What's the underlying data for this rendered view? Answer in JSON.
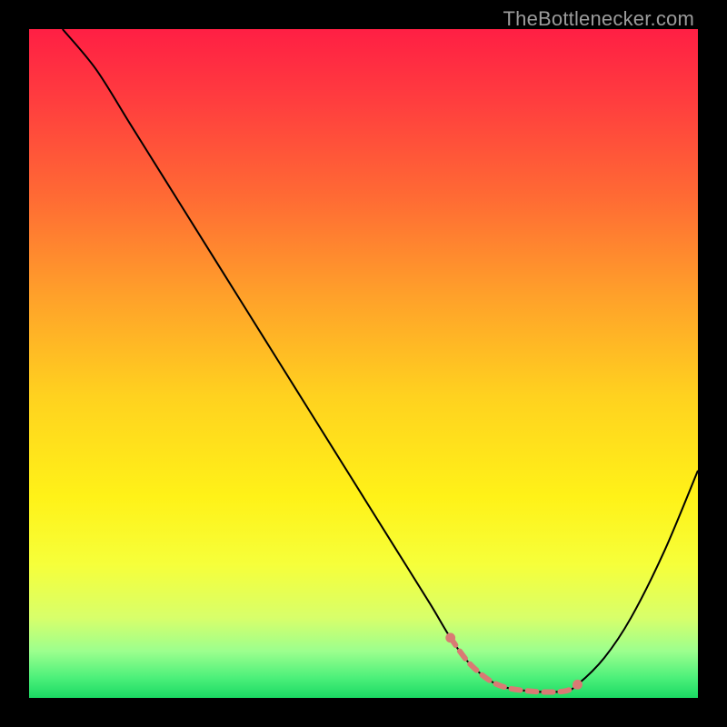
{
  "watermark": "TheBottlenecker.com",
  "chart_data": {
    "type": "line",
    "title": "",
    "xlabel": "",
    "ylabel": "",
    "xlim": [
      0,
      100
    ],
    "ylim": [
      0,
      100
    ],
    "grid": false,
    "background_gradient": {
      "stops": [
        {
          "offset": 0.0,
          "color": "#ff1f44"
        },
        {
          "offset": 0.1,
          "color": "#ff3b3f"
        },
        {
          "offset": 0.25,
          "color": "#ff6a34"
        },
        {
          "offset": 0.4,
          "color": "#ffa12a"
        },
        {
          "offset": 0.55,
          "color": "#ffd21f"
        },
        {
          "offset": 0.7,
          "color": "#fff218"
        },
        {
          "offset": 0.8,
          "color": "#f6ff3a"
        },
        {
          "offset": 0.88,
          "color": "#d8ff6a"
        },
        {
          "offset": 0.93,
          "color": "#9cff8e"
        },
        {
          "offset": 0.97,
          "color": "#4cf07a"
        },
        {
          "offset": 1.0,
          "color": "#1ad963"
        }
      ]
    },
    "series": [
      {
        "name": "bottleneck-curve",
        "color": "#000000",
        "width": 2,
        "x": [
          5,
          10,
          15,
          20,
          25,
          30,
          35,
          40,
          45,
          50,
          55,
          60,
          63,
          66,
          70,
          75,
          80,
          82,
          86,
          90,
          95,
          100
        ],
        "y": [
          100,
          94,
          86,
          78,
          70,
          62,
          54,
          46,
          38,
          30,
          22,
          14,
          9,
          5,
          2,
          1,
          1,
          2,
          6,
          12,
          22,
          34
        ]
      }
    ],
    "highlight_segment": {
      "name": "optimal-range",
      "color": "#d97a74",
      "width": 6,
      "dash": [
        10,
        8
      ],
      "caps": true,
      "x": [
        63,
        66,
        70,
        75,
        80,
        82
      ],
      "y": [
        9,
        5,
        2,
        1,
        1,
        2
      ]
    }
  }
}
